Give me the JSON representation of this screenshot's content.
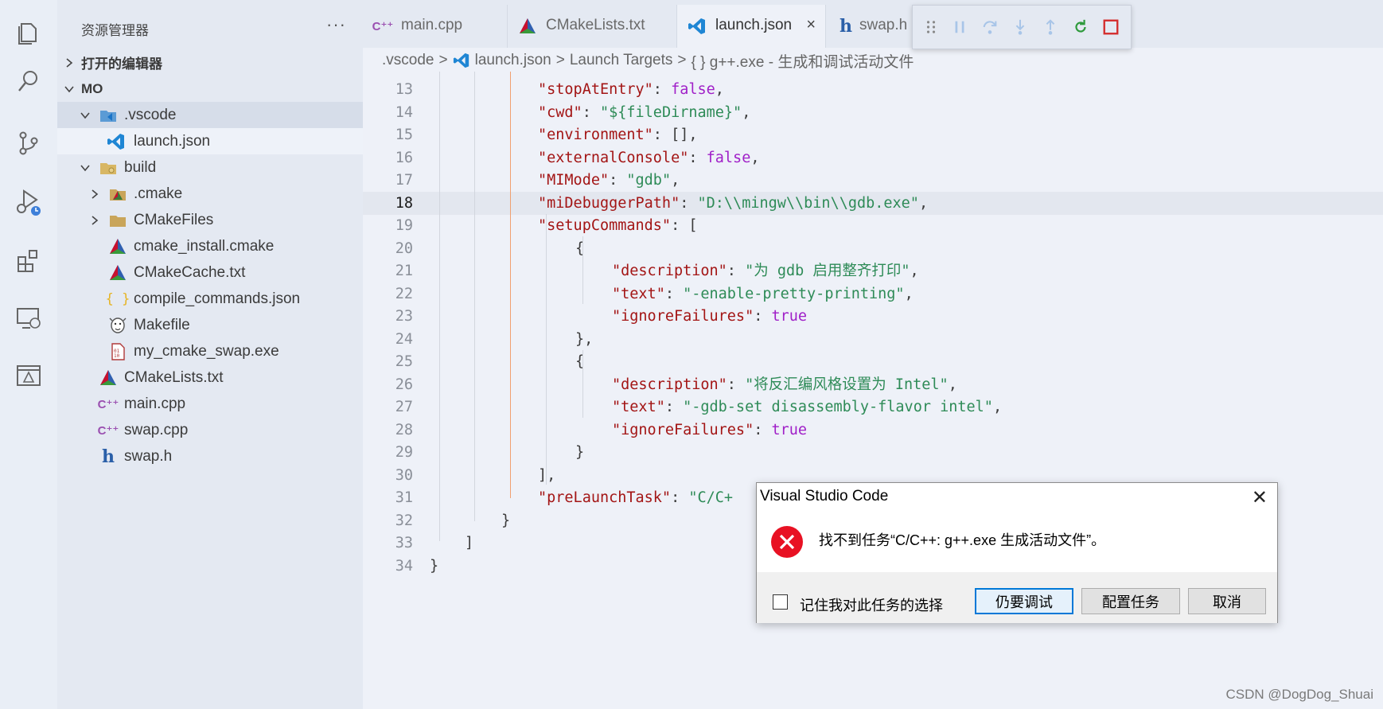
{
  "sidebar": {
    "title": "资源管理器",
    "more": "···",
    "open_editors": "打开的编辑器",
    "root": "MO",
    "tree": [
      {
        "label": ".vscode"
      },
      {
        "label": "launch.json"
      },
      {
        "label": "build"
      },
      {
        "label": ".cmake"
      },
      {
        "label": "CMakeFiles"
      },
      {
        "label": "cmake_install.cmake"
      },
      {
        "label": "CMakeCache.txt"
      },
      {
        "label": "compile_commands.json"
      },
      {
        "label": "Makefile"
      },
      {
        "label": "my_cmake_swap.exe"
      },
      {
        "label": "CMakeLists.txt"
      },
      {
        "label": "main.cpp"
      },
      {
        "label": "swap.cpp"
      },
      {
        "label": "swap.h"
      }
    ]
  },
  "tabs": [
    {
      "label": "main.cpp"
    },
    {
      "label": "CMakeLists.txt"
    },
    {
      "label": "launch.json",
      "close": "×"
    },
    {
      "label": "swap.h"
    }
  ],
  "breadcrumb": {
    "folder": ".vscode",
    "file": "launch.json",
    "section": "Launch Targets",
    "item": "{ } g++.exe - 生成和调试活动文件",
    "sep": ">"
  },
  "code": {
    "lines": [
      {
        "n": "13",
        "key": "\"stopAtEntry\"",
        "rest": ": ",
        "val": "false",
        "vt": "kw",
        "tail": ","
      },
      {
        "n": "14",
        "key": "\"cwd\"",
        "rest": ": ",
        "val": "\"${fileDirname}\"",
        "vt": "s",
        "tail": ","
      },
      {
        "n": "15",
        "key": "\"environment\"",
        "rest": ": [],",
        "val": "",
        "vt": "p",
        "tail": ""
      },
      {
        "n": "16",
        "key": "\"externalConsole\"",
        "rest": ": ",
        "val": "false",
        "vt": "kw",
        "tail": ","
      },
      {
        "n": "17",
        "key": "\"MIMode\"",
        "rest": ": ",
        "val": "\"gdb\"",
        "vt": "s",
        "tail": ","
      },
      {
        "n": "18",
        "key": "\"miDebuggerPath\"",
        "rest": ": ",
        "val": "\"D:\\\\mingw\\\\bin\\\\gdb.exe\"",
        "vt": "s",
        "tail": ","
      },
      {
        "n": "19",
        "key": "\"setupCommands\"",
        "rest": ": [",
        "val": "",
        "vt": "p",
        "tail": ""
      },
      {
        "n": "20",
        "key": "",
        "rest": "{",
        "val": "",
        "vt": "p",
        "tail": ""
      },
      {
        "n": "21",
        "key": "\"description\"",
        "rest": ": ",
        "val": "\"为 gdb 启用整齐打印\"",
        "vt": "s",
        "tail": ","
      },
      {
        "n": "22",
        "key": "\"text\"",
        "rest": ": ",
        "val": "\"-enable-pretty-printing\"",
        "vt": "s",
        "tail": ","
      },
      {
        "n": "23",
        "key": "\"ignoreFailures\"",
        "rest": ": ",
        "val": "true",
        "vt": "kw",
        "tail": ""
      },
      {
        "n": "24",
        "key": "",
        "rest": "},",
        "val": "",
        "vt": "p",
        "tail": ""
      },
      {
        "n": "25",
        "key": "",
        "rest": "{",
        "val": "",
        "vt": "p",
        "tail": ""
      },
      {
        "n": "26",
        "key": "\"description\"",
        "rest": ": ",
        "val": "\"将反汇编风格设置为 Intel\"",
        "vt": "s",
        "tail": ","
      },
      {
        "n": "27",
        "key": "\"text\"",
        "rest": ": ",
        "val": "\"-gdb-set disassembly-flavor intel\"",
        "vt": "s",
        "tail": ","
      },
      {
        "n": "28",
        "key": "\"ignoreFailures\"",
        "rest": ": ",
        "val": "true",
        "vt": "kw",
        "tail": ""
      },
      {
        "n": "29",
        "key": "",
        "rest": "}",
        "val": "",
        "vt": "p",
        "tail": ""
      },
      {
        "n": "30",
        "key": "",
        "rest": "],",
        "val": "",
        "vt": "p",
        "tail": ""
      },
      {
        "n": "31",
        "key": "\"preLaunchTask\"",
        "rest": ": ",
        "val": "\"C/C+",
        "vt": "s",
        "tail": ""
      },
      {
        "n": "32",
        "key": "",
        "rest": "}",
        "val": "",
        "vt": "p",
        "tail": ""
      },
      {
        "n": "33",
        "key": "",
        "rest": "]",
        "val": "",
        "vt": "p",
        "tail": ""
      },
      {
        "n": "34",
        "key": "",
        "rest": "}",
        "val": "",
        "vt": "p",
        "tail": ""
      }
    ],
    "current_line": "18"
  },
  "dialog": {
    "title": "Visual Studio Code",
    "close": "✕",
    "message": "找不到任务“C/C++: g++.exe 生成活动文件”。",
    "checkbox_label": "记住我对此任务的选择",
    "buttons": {
      "debug_anyway": "仍要调试",
      "configure": "配置任务",
      "cancel": "取消"
    }
  },
  "watermark": "CSDN @DogDog_Shuai",
  "colors": {
    "accent": "#0078d7",
    "error": "#e81123",
    "restart": "#2e9a3c",
    "stop": "#d42e2e"
  }
}
